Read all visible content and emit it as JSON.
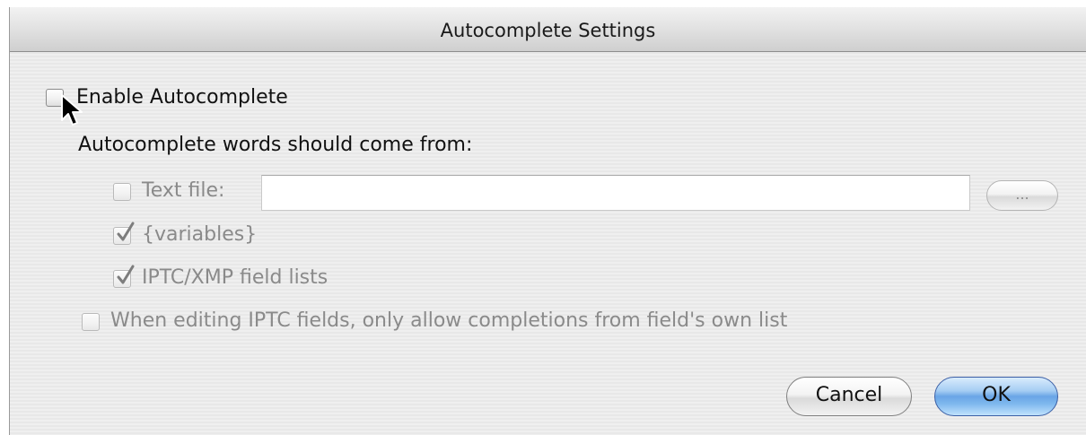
{
  "window": {
    "title": "Autocomplete Settings"
  },
  "options": {
    "enable_autocomplete": {
      "label": "Enable Autocomplete",
      "checked": false
    },
    "source_heading": "Autocomplete words should come from:",
    "text_file": {
      "label": "Text file:",
      "checked": false,
      "value": "",
      "enabled": false
    },
    "browse_label": "...",
    "variables": {
      "label": "{variables}",
      "checked": true,
      "enabled": false
    },
    "iptc_lists": {
      "label": "IPTC/XMP field lists",
      "checked": true,
      "enabled": false
    },
    "own_list_only": {
      "label": "When editing IPTC fields, only allow completions from field's own list",
      "checked": false,
      "enabled": false
    }
  },
  "buttons": {
    "cancel": "Cancel",
    "ok": "OK"
  },
  "colors": {
    "accent": "#6aa5e6",
    "dim_text": "#8a8a8a"
  },
  "icons": {
    "cursor": "arrow-pointer-icon",
    "check": "checkmark-icon"
  }
}
